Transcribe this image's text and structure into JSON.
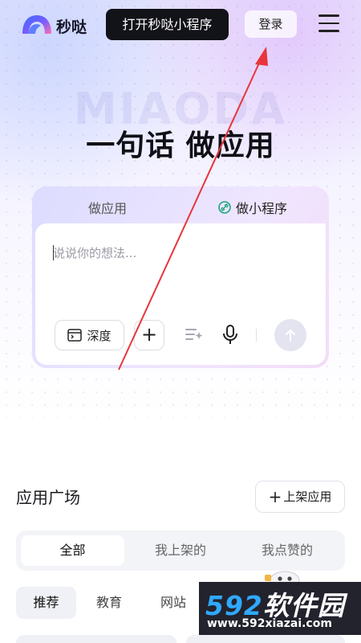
{
  "header": {
    "logo_text": "秒哒",
    "mini_program_button": "打开秒哒小程序",
    "login_button": "登录",
    "logo_icon": "miaoda-logo-icon",
    "menu_icon": "menu-icon"
  },
  "hero": {
    "watermark": "MIAODA",
    "title": "一句话  做应用"
  },
  "composer": {
    "tabs": [
      "做应用",
      "做小程序"
    ],
    "active_tab": "做小程序",
    "placeholder": "说说你的想法...",
    "depth_button": "深度",
    "plus_button": "+",
    "icons": [
      "depth-icon",
      "plus-icon",
      "magic-list-icon",
      "microphone-icon",
      "send-arrow-icon"
    ]
  },
  "app_square": {
    "title": "应用广场",
    "publish_button": "上架应用",
    "segments": [
      "全部",
      "我上架的",
      "我点赞的"
    ],
    "active_segment": "全部",
    "filters": [
      "推荐",
      "教育",
      "网站"
    ],
    "active_filter": "推荐"
  },
  "site_watermark": {
    "number": "592",
    "name": "软件园",
    "url": "www.592xiazai.com"
  },
  "colors": {
    "accent_dark": "#121219",
    "annotation_arrow": "#e8353b",
    "watermark_blue": "#2fa9ff"
  }
}
